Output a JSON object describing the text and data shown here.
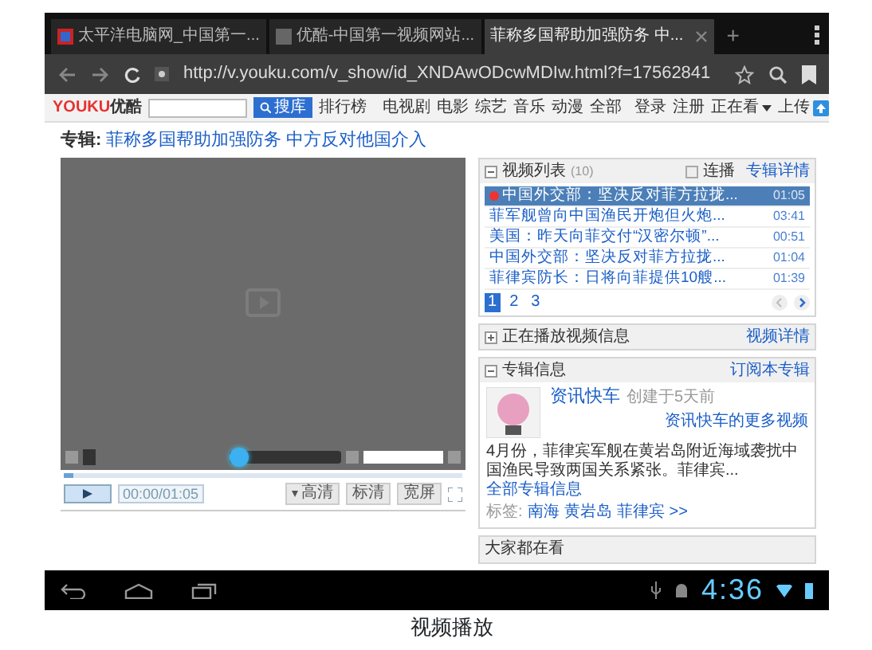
{
  "browser": {
    "tabs": [
      {
        "title": "太平洋电脑网_中国第一...",
        "selected": false,
        "kind": "logo"
      },
      {
        "title": "优酷-中国第一视频网站...",
        "selected": false,
        "kind": "blank"
      },
      {
        "title": "菲称多国帮助加强防务 中...",
        "selected": true,
        "kind": "plain"
      }
    ],
    "new_tab": "+",
    "url": "http://v.youku.com/v_show/id_XNDAwODcwMDIw.html?f=17562841"
  },
  "site_header": {
    "logo": "YOUKU",
    "logo_cn": "优酷",
    "search_button": "搜库",
    "ranking": "排行榜",
    "nav": [
      "电视剧",
      "电影",
      "综艺",
      "音乐",
      "动漫",
      "全部"
    ],
    "user_links": [
      "登录",
      "注册"
    ],
    "watching": "正在看",
    "upload": "上传"
  },
  "album_title": {
    "label": "专辑:",
    "title": "菲称多国帮助加强防务 中方反对他国介入"
  },
  "player": {
    "volume": {
      "level": 0
    },
    "progress": {
      "level": 0
    },
    "time": "00:00/01:05",
    "options": [
      {
        "label": "高清",
        "kind": "dropdown"
      },
      {
        "label": "标清",
        "kind": "button"
      },
      {
        "label": "宽屏",
        "kind": "button"
      }
    ]
  },
  "video_list": {
    "title": "视频列表",
    "count": "(10)",
    "autoplay": {
      "label": "连播",
      "checked": false
    },
    "link": "专辑详情",
    "items": [
      {
        "title": "中国外交部：坚决反对菲方拉拢...",
        "duration": "01:05",
        "selected": true
      },
      {
        "title": "菲军舰曾向中国渔民开炮但火炮...",
        "duration": "03:41",
        "selected": false
      },
      {
        "title": "美国：昨天向菲交付“汉密尔顿”...",
        "duration": "00:51",
        "selected": false
      },
      {
        "title": "中国外交部：坚决反对菲方拉拢...",
        "duration": "01:04",
        "selected": false
      },
      {
        "title": "菲律宾防长：日将向菲提供10艘...",
        "duration": "01:39",
        "selected": false
      }
    ],
    "pages": [
      {
        "label": "1",
        "selected": true
      },
      {
        "label": "2",
        "selected": false
      },
      {
        "label": "3",
        "selected": false
      }
    ]
  },
  "now_playing": {
    "title": "正在播放视频信息",
    "link": "视频详情",
    "expanded": false
  },
  "album_info": {
    "title": "专辑信息",
    "link": "订阅本专辑",
    "expanded": true,
    "name": "资讯快车",
    "created": "创建于5天前",
    "more": "资讯快车的更多视频",
    "description": "4月份，菲律宾军舰在黄岩岛附近海域袭扰中国渔民导致两国关系紧张。菲律宾...",
    "description_link": "全部专辑信息",
    "tags_label": "标签:",
    "tags": [
      "南海",
      "黄岩岛",
      "菲律宾"
    ],
    "tags_more": ">>"
  },
  "popular": {
    "title": "大家都在看"
  },
  "status_bar": {
    "time": "4:36"
  },
  "caption": "视频播放"
}
